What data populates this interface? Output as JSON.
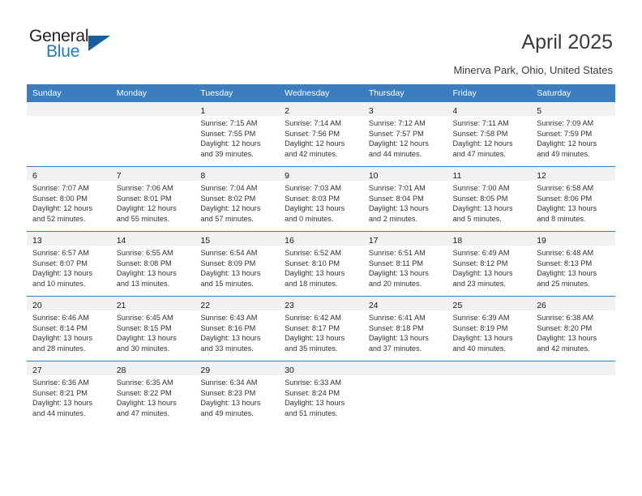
{
  "logo": {
    "word_top": "General",
    "word_bottom": "Blue",
    "triangle_color": "#16609e",
    "blue_color": "#1f7ac0"
  },
  "header": {
    "title": "April 2025",
    "subtitle": "Minerva Park, Ohio, United States"
  },
  "calendar": {
    "accent_color": "#3a7ebf",
    "daynum_band_color": "#f1f1f1",
    "weekday_headers": [
      "Sunday",
      "Monday",
      "Tuesday",
      "Wednesday",
      "Thursday",
      "Friday",
      "Saturday"
    ],
    "weeks": [
      [
        {
          "day": "",
          "lines": []
        },
        {
          "day": "",
          "lines": []
        },
        {
          "day": "1",
          "lines": [
            "Sunrise: 7:15 AM",
            "Sunset: 7:55 PM",
            "Daylight: 12 hours",
            "and 39 minutes."
          ]
        },
        {
          "day": "2",
          "lines": [
            "Sunrise: 7:14 AM",
            "Sunset: 7:56 PM",
            "Daylight: 12 hours",
            "and 42 minutes."
          ]
        },
        {
          "day": "3",
          "lines": [
            "Sunrise: 7:12 AM",
            "Sunset: 7:57 PM",
            "Daylight: 12 hours",
            "and 44 minutes."
          ]
        },
        {
          "day": "4",
          "lines": [
            "Sunrise: 7:11 AM",
            "Sunset: 7:58 PM",
            "Daylight: 12 hours",
            "and 47 minutes."
          ]
        },
        {
          "day": "5",
          "lines": [
            "Sunrise: 7:09 AM",
            "Sunset: 7:59 PM",
            "Daylight: 12 hours",
            "and 49 minutes."
          ]
        }
      ],
      [
        {
          "day": "6",
          "lines": [
            "Sunrise: 7:07 AM",
            "Sunset: 8:00 PM",
            "Daylight: 12 hours",
            "and 52 minutes."
          ]
        },
        {
          "day": "7",
          "lines": [
            "Sunrise: 7:06 AM",
            "Sunset: 8:01 PM",
            "Daylight: 12 hours",
            "and 55 minutes."
          ]
        },
        {
          "day": "8",
          "lines": [
            "Sunrise: 7:04 AM",
            "Sunset: 8:02 PM",
            "Daylight: 12 hours",
            "and 57 minutes."
          ]
        },
        {
          "day": "9",
          "lines": [
            "Sunrise: 7:03 AM",
            "Sunset: 8:03 PM",
            "Daylight: 13 hours",
            "and 0 minutes."
          ]
        },
        {
          "day": "10",
          "lines": [
            "Sunrise: 7:01 AM",
            "Sunset: 8:04 PM",
            "Daylight: 13 hours",
            "and 2 minutes."
          ]
        },
        {
          "day": "11",
          "lines": [
            "Sunrise: 7:00 AM",
            "Sunset: 8:05 PM",
            "Daylight: 13 hours",
            "and 5 minutes."
          ]
        },
        {
          "day": "12",
          "lines": [
            "Sunrise: 6:58 AM",
            "Sunset: 8:06 PM",
            "Daylight: 13 hours",
            "and 8 minutes."
          ]
        }
      ],
      [
        {
          "day": "13",
          "lines": [
            "Sunrise: 6:57 AM",
            "Sunset: 8:07 PM",
            "Daylight: 13 hours",
            "and 10 minutes."
          ]
        },
        {
          "day": "14",
          "lines": [
            "Sunrise: 6:55 AM",
            "Sunset: 8:08 PM",
            "Daylight: 13 hours",
            "and 13 minutes."
          ]
        },
        {
          "day": "15",
          "lines": [
            "Sunrise: 6:54 AM",
            "Sunset: 8:09 PM",
            "Daylight: 13 hours",
            "and 15 minutes."
          ]
        },
        {
          "day": "16",
          "lines": [
            "Sunrise: 6:52 AM",
            "Sunset: 8:10 PM",
            "Daylight: 13 hours",
            "and 18 minutes."
          ]
        },
        {
          "day": "17",
          "lines": [
            "Sunrise: 6:51 AM",
            "Sunset: 8:11 PM",
            "Daylight: 13 hours",
            "and 20 minutes."
          ]
        },
        {
          "day": "18",
          "lines": [
            "Sunrise: 6:49 AM",
            "Sunset: 8:12 PM",
            "Daylight: 13 hours",
            "and 23 minutes."
          ]
        },
        {
          "day": "19",
          "lines": [
            "Sunrise: 6:48 AM",
            "Sunset: 8:13 PM",
            "Daylight: 13 hours",
            "and 25 minutes."
          ]
        }
      ],
      [
        {
          "day": "20",
          "lines": [
            "Sunrise: 6:46 AM",
            "Sunset: 8:14 PM",
            "Daylight: 13 hours",
            "and 28 minutes."
          ]
        },
        {
          "day": "21",
          "lines": [
            "Sunrise: 6:45 AM",
            "Sunset: 8:15 PM",
            "Daylight: 13 hours",
            "and 30 minutes."
          ]
        },
        {
          "day": "22",
          "lines": [
            "Sunrise: 6:43 AM",
            "Sunset: 8:16 PM",
            "Daylight: 13 hours",
            "and 33 minutes."
          ]
        },
        {
          "day": "23",
          "lines": [
            "Sunrise: 6:42 AM",
            "Sunset: 8:17 PM",
            "Daylight: 13 hours",
            "and 35 minutes."
          ]
        },
        {
          "day": "24",
          "lines": [
            "Sunrise: 6:41 AM",
            "Sunset: 8:18 PM",
            "Daylight: 13 hours",
            "and 37 minutes."
          ]
        },
        {
          "day": "25",
          "lines": [
            "Sunrise: 6:39 AM",
            "Sunset: 8:19 PM",
            "Daylight: 13 hours",
            "and 40 minutes."
          ]
        },
        {
          "day": "26",
          "lines": [
            "Sunrise: 6:38 AM",
            "Sunset: 8:20 PM",
            "Daylight: 13 hours",
            "and 42 minutes."
          ]
        }
      ],
      [
        {
          "day": "27",
          "lines": [
            "Sunrise: 6:36 AM",
            "Sunset: 8:21 PM",
            "Daylight: 13 hours",
            "and 44 minutes."
          ]
        },
        {
          "day": "28",
          "lines": [
            "Sunrise: 6:35 AM",
            "Sunset: 8:22 PM",
            "Daylight: 13 hours",
            "and 47 minutes."
          ]
        },
        {
          "day": "29",
          "lines": [
            "Sunrise: 6:34 AM",
            "Sunset: 8:23 PM",
            "Daylight: 13 hours",
            "and 49 minutes."
          ]
        },
        {
          "day": "30",
          "lines": [
            "Sunrise: 6:33 AM",
            "Sunset: 8:24 PM",
            "Daylight: 13 hours",
            "and 51 minutes."
          ]
        },
        {
          "day": "",
          "lines": []
        },
        {
          "day": "",
          "lines": []
        },
        {
          "day": "",
          "lines": []
        }
      ]
    ]
  }
}
